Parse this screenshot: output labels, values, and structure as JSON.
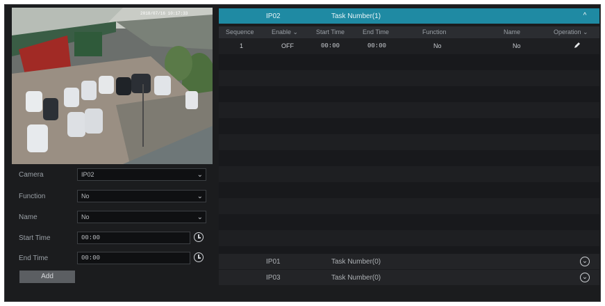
{
  "left": {
    "form": {
      "camera_label": "Camera",
      "camera_value": "IP02",
      "function_label": "Function",
      "function_value": "No",
      "name_label": "Name",
      "name_value": "No",
      "start_label": "Start Time",
      "start_value": "00:00",
      "end_label": "End Time",
      "end_value": "00:00"
    },
    "add_label": "Add",
    "preview_timestamp": "2018/07/16 10:17:33"
  },
  "groups": [
    {
      "camera": "IP02",
      "task": "Task Number(1)",
      "expanded": true
    },
    {
      "camera": "IP01",
      "task": "Task Number(0)",
      "expanded": false
    },
    {
      "camera": "IP03",
      "task": "Task Number(0)",
      "expanded": false
    }
  ],
  "table": {
    "headers": {
      "sequence": "Sequence",
      "enable": "Enable",
      "start": "Start Time",
      "end": "End Time",
      "function": "Function",
      "name": "Name",
      "operation": "Operation"
    },
    "rows": [
      {
        "sequence": "1",
        "enable": "OFF",
        "start": "00:00",
        "end": "00:00",
        "function": "No",
        "name": "No"
      }
    ]
  },
  "colors": {
    "accent": "#1f8aa3",
    "panel": "#1b1c1e"
  }
}
